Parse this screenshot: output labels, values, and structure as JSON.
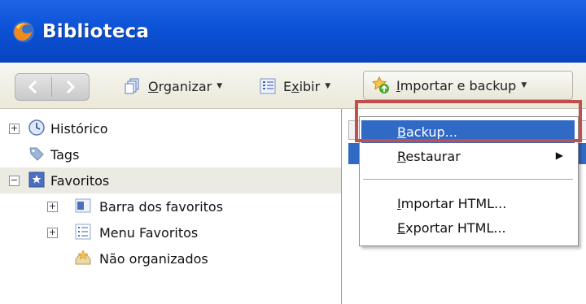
{
  "window": {
    "title": "Biblioteca",
    "title_color": "#0b52d6"
  },
  "toolbar": {
    "organize": {
      "label_pre": "",
      "label_ul": "O",
      "label_post": "rganizar"
    },
    "view": {
      "label_pre": "E",
      "label_ul": "x",
      "label_post": "ibir"
    },
    "import": {
      "label_pre": "",
      "label_ul": "I",
      "label_post": "mportar e backup"
    }
  },
  "tree": {
    "items": [
      {
        "label": "Histórico",
        "icon": "clock-icon",
        "expander": "+"
      },
      {
        "label": "Tags",
        "icon": "tag-icon",
        "expander": ""
      },
      {
        "label": "Favoritos",
        "icon": "star-folder-icon",
        "expander": "−"
      },
      {
        "label": "Barra dos favoritos",
        "icon": "bookmarks-bar-icon",
        "expander": "+"
      },
      {
        "label": "Menu Favoritos",
        "icon": "bookmarks-menu-icon",
        "expander": "+"
      },
      {
        "label": "Não organizados",
        "icon": "unsorted-bookmarks-icon",
        "expander": ""
      }
    ]
  },
  "menu": {
    "backup": {
      "ul": "B",
      "rest": "ackup..."
    },
    "restore": {
      "ul": "R",
      "rest": "estaurar"
    },
    "import_html": {
      "ul": "I",
      "rest": "mportar HTML..."
    },
    "export_html": {
      "ul": "E",
      "rest": "xportar HTML..."
    }
  },
  "colors": {
    "highlight": "#316ac5",
    "annotation": "#c0504d"
  }
}
